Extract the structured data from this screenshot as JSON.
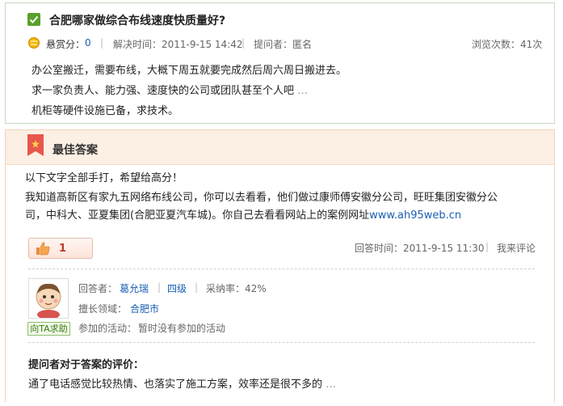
{
  "question": {
    "title": "合肥哪家做综合布线速度快质量好?",
    "reward_label": "悬赏分：",
    "reward_value": "0",
    "separator": "|",
    "solved_time": "解决时间：2011-9-15 14:42",
    "asker": "提问者：匿名",
    "views": "浏览次数：41次",
    "body_lines": [
      "办公室搬迁，需要布线，大概下周五就要完成然后周六周日搬进去。",
      "求一家负责人、能力强、速度快的公司或团队甚至个人吧",
      "机柜等硬件设施已备，求技术。"
    ],
    "ellipsis": "…"
  },
  "answer": {
    "header_label": "最佳答案",
    "body_lines": [
      "以下文字全部手打，希望给高分！",
      "我知道高新区有家九五网络布线公司，你可以去看看，他们做过康师傅安徽分公司，旺旺集团安徽分公",
      "司，中科大、亚夏集团(合肥亚夏汽车城)。你自己去看看网站上的案例网址"
    ],
    "link_text": "www.ah95web.cn",
    "like_count": "1",
    "answer_time": "回答时间：2011-9-15 11:30",
    "separator": "|",
    "comment_label": "我来评论",
    "answerer_label": "回答者：",
    "answerer_name": "葛允瑞",
    "level": "四级",
    "adopt_rate": "采纳率：42%",
    "field_label": "擅长领域：",
    "field_value": "合肥市",
    "activity_label": "参加的活动：",
    "activity_value": "暂时没有参加的活动",
    "help_button": "向TA求助"
  },
  "evaluation": {
    "title": "提问者对于答案的评价：",
    "text": "通了电话感觉比较热情、也落实了施工方案，效率还是很不多的",
    "ellipsis": "…"
  },
  "colors": {
    "link": "#1a5fb4",
    "accent_green": "#5aa02c",
    "answer_header_bg": "#fcefe3"
  },
  "icons": [
    "check-icon",
    "coin-icon",
    "ribbon-icon",
    "thumbs-up-icon",
    "avatar"
  ]
}
